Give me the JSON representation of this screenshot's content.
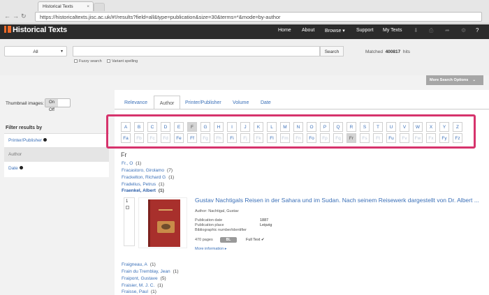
{
  "browser": {
    "tab_title": "Historical Texts",
    "url": "https://historicaltexts.jisc.ac.uk/#!/results?field=all&type=publication&size=30&terms=*&mode=by-author"
  },
  "header": {
    "logo": "Historical Texts",
    "nav": [
      "Home",
      "About",
      "Browse ▾",
      "Support",
      "My Texts"
    ]
  },
  "search": {
    "field_select": "All",
    "button": "Search",
    "fuzzy": "Fuzzy search",
    "variant": "Variant spelling",
    "matched_label": "Matched",
    "matched_count": "400817",
    "matched_suffix": "hits",
    "more_options": "More Search Options"
  },
  "sidebar": {
    "thumbnail_label": "Thumbnail images:",
    "toggle_on": "On",
    "toggle_off": "Off",
    "filter_title": "Filter results by",
    "filters": [
      "Printer/Publisher",
      "Author",
      "Date"
    ]
  },
  "sort_tabs": [
    "Relevance",
    "Author",
    "Printer/Publisher",
    "Volume",
    "Date"
  ],
  "letters": [
    "A",
    "B",
    "C",
    "D",
    "E",
    "F",
    "G",
    "H",
    "I",
    "J",
    "K",
    "L",
    "M",
    "N",
    "O",
    "P",
    "Q",
    "R",
    "S",
    "T",
    "U",
    "V",
    "W",
    "X",
    "Y",
    "Z"
  ],
  "sub_letters": [
    "Fa",
    "Fb",
    "Fc",
    "Fd",
    "Fe",
    "Ff",
    "Fg",
    "Fh",
    "Fi",
    "Fj",
    "Fk",
    "Fl",
    "Fm",
    "Fn",
    "Fo",
    "Fp",
    "Fq",
    "Fr",
    "Fs",
    "Ft",
    "Fu",
    "Fv",
    "Fw",
    "Fx",
    "Fy",
    "Fz"
  ],
  "selected_letter": "F",
  "selected_sub": "Fr",
  "section_heading": "Fr",
  "authors_top": [
    {
      "name": "Fr., O",
      "count": "(1)"
    },
    {
      "name": "Fracastoro, Girolamo",
      "count": "(7)"
    },
    {
      "name": "Frackelton, Richard G",
      "count": "(1)"
    },
    {
      "name": "Fradelius, Petrus",
      "count": "(1)"
    },
    {
      "name": "Fraenkel, Albert",
      "count": "(1)"
    }
  ],
  "record": {
    "index": "1",
    "title": "Gustav Nachtigals Reisen in der Sahara und im Sudan. Nach seinem Reisewerk dargestellt von Dr. Albert ...",
    "author_line": "Author: Nachtigal, Gustav",
    "rows": [
      {
        "label": "Publication date",
        "value": "1887"
      },
      {
        "label": "Publication place",
        "value": "Leipzig"
      },
      {
        "label": "Bibliographic number/identifier",
        "value": ""
      }
    ],
    "pages": "470 pages",
    "pill": "BL",
    "fulltext": "Full Text ✔",
    "more_info": "More information ▸"
  },
  "authors_bottom": [
    {
      "name": "Fraigneau, A",
      "count": "(1)"
    },
    {
      "name": "Frain du Tremblay, Jean",
      "count": "(1)"
    },
    {
      "name": "Fraipont, Gustave",
      "count": "(5)"
    },
    {
      "name": "Fraisier, M. J. C.",
      "count": "(1)"
    },
    {
      "name": "Fraisse, Paul",
      "count": "(1)"
    }
  ],
  "colors": {
    "accent": "#3b70b8",
    "highlight": "#d6336c",
    "header": "#2b2b2b",
    "logo_mark": "#f06a28"
  }
}
